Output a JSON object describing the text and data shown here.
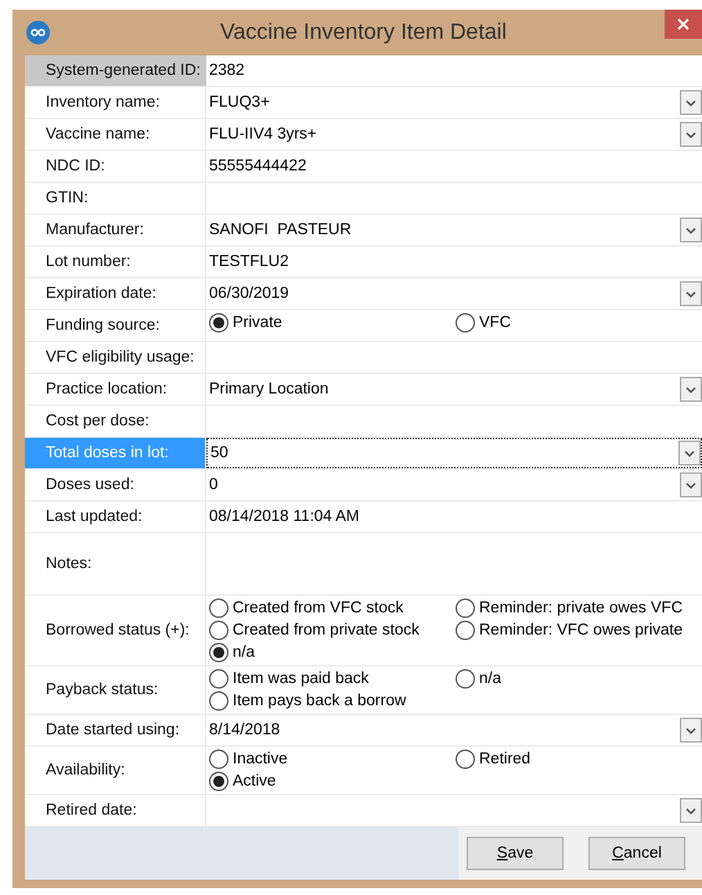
{
  "window": {
    "title": "Vaccine Inventory Item Detail"
  },
  "system_id": {
    "label": "System-generated ID:",
    "value": "2382"
  },
  "rows": [
    {
      "kind": "dropdown",
      "label": "Inventory name:",
      "value": "FLUQ3+",
      "selected": false
    },
    {
      "kind": "dropdown",
      "label": "Vaccine name:",
      "value": "FLU-IIV4 3yrs+",
      "selected": false
    },
    {
      "kind": "text",
      "label": "NDC ID:",
      "value": "55555444422",
      "selected": false
    },
    {
      "kind": "text",
      "label": "GTIN:",
      "selected": false
    },
    {
      "kind": "dropdown",
      "label": "Manufacturer:",
      "value": "SANOFI  PASTEUR",
      "selected": false
    },
    {
      "kind": "text",
      "label": "Lot number:",
      "value": "TESTFLU2",
      "selected": false
    },
    {
      "kind": "dropdown",
      "label": "Expiration date:",
      "value": "06/30/2019",
      "selected": false
    },
    {
      "kind": "radio",
      "label": "Funding source:",
      "selected": false,
      "options": [
        {
          "label": "Private",
          "selected": true
        },
        {
          "label": "VFC",
          "selected": false
        }
      ]
    },
    {
      "kind": "text",
      "label": "VFC eligibility usage:",
      "selected": false
    },
    {
      "kind": "dropdown",
      "label": "Practice location:",
      "value": "Primary Location",
      "selected": false
    },
    {
      "kind": "text",
      "label": "Cost per dose:",
      "selected": false
    },
    {
      "kind": "dropdown",
      "label": "Total doses in lot:",
      "value": "50",
      "selected": true
    },
    {
      "kind": "dropdown",
      "label": "Doses used:",
      "value": "0",
      "selected": false
    },
    {
      "kind": "text",
      "label": "Last updated:",
      "value": "08/14/2018 11:04 AM",
      "selected": false
    },
    {
      "kind": "notes",
      "label": "Notes:",
      "selected": false
    },
    {
      "kind": "radio",
      "label": "Borrowed status (+):",
      "selected": false,
      "options": [
        {
          "label": "Created from VFC stock",
          "selected": false
        },
        {
          "label": "Reminder: private owes VFC",
          "selected": false
        },
        {
          "label": "Created from private stock",
          "selected": false
        },
        {
          "label": "Reminder: VFC owes private",
          "selected": false
        },
        {
          "label": "n/a",
          "selected": true
        }
      ]
    },
    {
      "kind": "radio",
      "label": "Payback status:",
      "selected": false,
      "options": [
        {
          "label": "Item was paid back",
          "selected": false
        },
        {
          "label": "n/a",
          "selected": false
        },
        {
          "label": "Item pays back a borrow",
          "selected": false
        }
      ]
    },
    {
      "kind": "dropdown",
      "label": "Date started using:",
      "value": "8/14/2018",
      "selected": false
    },
    {
      "kind": "radio",
      "label": "Availability:",
      "selected": false,
      "options": [
        {
          "label": "Inactive",
          "selected": false
        },
        {
          "label": "Retired",
          "selected": false
        },
        {
          "label": "Active",
          "selected": true
        }
      ]
    },
    {
      "kind": "dropdown",
      "label": "Retired date:",
      "selected": false
    }
  ],
  "buttons": [
    "Save",
    "Cancel"
  ]
}
